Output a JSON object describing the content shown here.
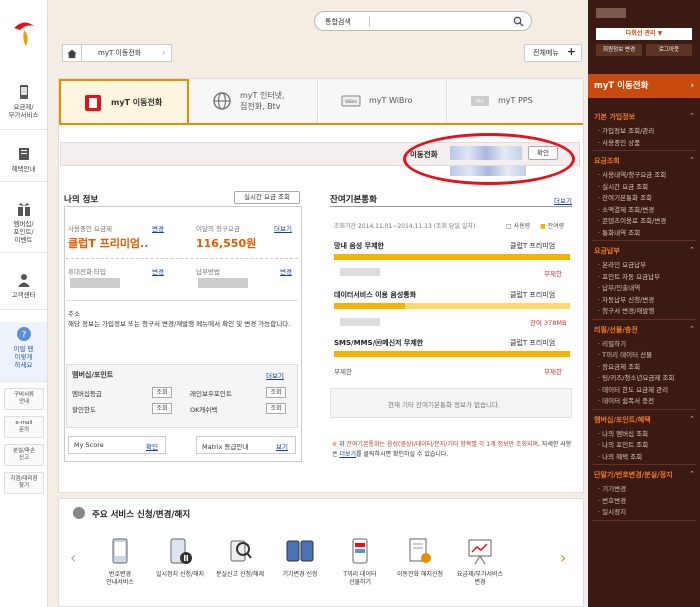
{
  "header": {
    "search_label": "통합검색",
    "breadcrumb": "myT 이동전화",
    "full_menu": "전체메뉴"
  },
  "left_rail": {
    "items": [
      "요금제/\n부가서비스",
      "혜택안내",
      "멤버십/\n포인트/\n이벤트",
      "고객센터",
      "이럴 땐\n이렇게\n하세요"
    ],
    "small_items": [
      "구비서류\n안내",
      "e-mail\n문의",
      "분실/파손\n신고",
      "지점/대리점\n찾기"
    ]
  },
  "tabs": [
    {
      "label": "myT 이동전화"
    },
    {
      "label": "myT 인터넷,",
      "label2": "집전화, Btv"
    },
    {
      "label": "myT WiBro"
    },
    {
      "label": "myT PPS"
    }
  ],
  "phone": {
    "label": "이동전화",
    "confirm": "확인"
  },
  "my_info": {
    "title": "나의 정보",
    "realtime_btn": "실시간 요금 조회",
    "plan_label": "사용중인 요금제",
    "change": "변경",
    "plan_value": "클럽T 프리미엄..",
    "bill_label": "이달의 청구요금",
    "more": "더보기",
    "bill_value": "116,550원",
    "phone_type_label": "휴대전화 타입",
    "payment_label": "납부방법",
    "notice_title": "주소",
    "notice_text": "해당 정보는 가입정보 또는 청구서 변경/재발행 메뉴에서 확인 및 변경 가능합니다.",
    "notice_link1": "가입정보",
    "notice_link2": "청구서 변경/재발행",
    "membership_title": "멤버십/포인트",
    "membership_more": "더보기",
    "rows": [
      {
        "left": "멤버십등급",
        "right": "레인보우포인트"
      },
      {
        "left": "할인한도",
        "right": "OK캐쉬백"
      }
    ],
    "lookup": "조회",
    "myscore": "My Score",
    "myscore_btn": "확인",
    "matrix": "Matrix 등급안내",
    "matrix_btn": "보기"
  },
  "remaining": {
    "title": "잔여기본통화",
    "more": "더보기",
    "period": "조회기간 2014.11.01~2014.11.13 (조회 당일 일자)",
    "legend_used": "사용량",
    "legend_left": "잔여량",
    "items": [
      {
        "title": "망내 음성 무제한",
        "plan": "클럽T 프리미엄",
        "value": "무제한",
        "fill": 1.0
      },
      {
        "title": "데이터서비스 이용 음성통화",
        "plan": "클럽T 프리미엄",
        "value": "잔여 378MB",
        "fill": 0.3
      },
      {
        "title": "SMS/MMS/ⓜ메신저 무제한",
        "plan": "클럽T 프리미엄",
        "value": "무제한",
        "fill": 1.0
      }
    ],
    "left_bottom": "무제한",
    "no_info": "현재 기타 잔여기본통화 정보가 없습니다.",
    "note_prefix": "위 ",
    "note_red": "잔여기본통화는 음성(영상)/데이터/문자/기타 항목별 각 1개 정보만 조회되며",
    "note_suffix": ", 자세한 사항은 ",
    "note_link": "더보기",
    "note_end": "를 클릭하시면 확인하실 수 있습니다."
  },
  "services": {
    "title": "주요 서비스 신청/변경/해지",
    "items": [
      "번호변경\n안내서비스",
      "일시정지 신청/해지",
      "분실신고 신청/해제",
      "기기변경 신청",
      "T끼리 데이터\n선물하기",
      "이동전화 해지신청",
      "요금제/부가서비스\n변경"
    ]
  },
  "right_panel": {
    "btn1": "다회선 관리 ▼",
    "btn2": "회원정보 변경",
    "btn3": "로그아웃",
    "head": "myT 이동전화",
    "sections": [
      {
        "title": "기본 가입정보",
        "items": [
          "가입정보 조회/관리",
          "사용중인 상품"
        ]
      },
      {
        "title": "요금조회",
        "items": [
          "사용내역/청구요금 조회",
          "실시간 요금 조회",
          "잔여기본통화 조회",
          "소액결제 조회/변경",
          "콘텐츠이용료 조회/변경",
          "통화내역 조회"
        ]
      },
      {
        "title": "요금납부",
        "items": [
          "온라인 요금납부",
          "포인트 자동 요금납부",
          "납부/인출내역",
          "자동납부 신청/변경",
          "청구서 변경/재발행"
        ]
      },
      {
        "title": "리필/선물/충전",
        "items": [
          "리필하기",
          "T끼리 데이터 선물",
          "장요금제 조회",
          "팅/키즈/청소년요금제 조회",
          "데이터 한도 요금제 관리",
          "데이터 쉼폭서 충전"
        ]
      },
      {
        "title": "멤버십/포인트/혜택",
        "items": [
          "나의 멤버십 조회",
          "나의 포인트 조회",
          "나의 혜택 조회"
        ]
      },
      {
        "title": "단말기/번호변경/분실/정지",
        "items": [
          "기기변경",
          "번호변경",
          "일시정지"
        ]
      }
    ]
  },
  "colors": {
    "accent": "#e68e00",
    "right_panel_bg": "#3a1a12",
    "right_head": "#c84a0e",
    "red_oval": "#e8101a"
  }
}
